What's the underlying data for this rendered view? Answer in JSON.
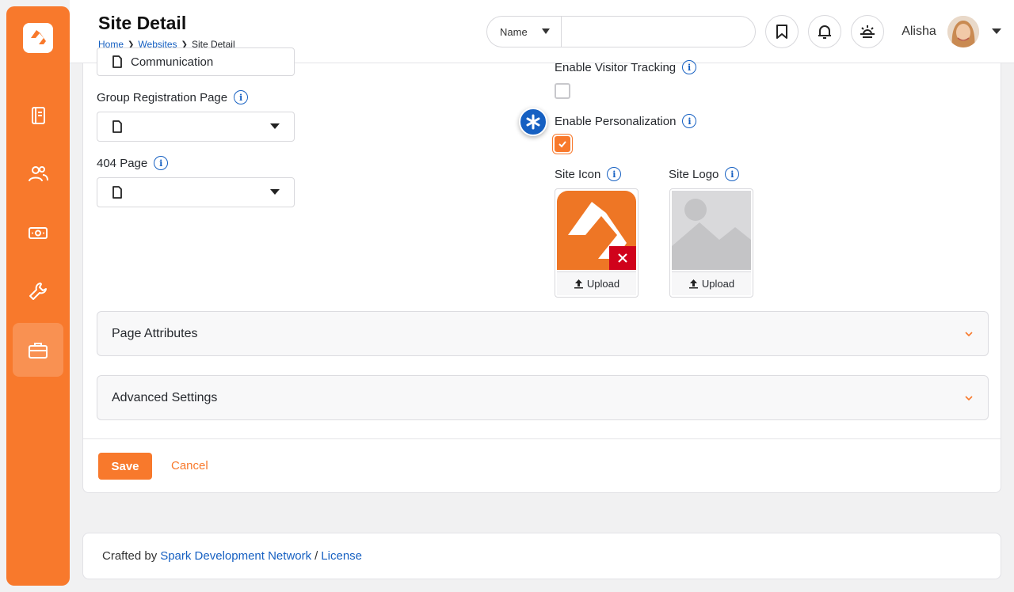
{
  "header": {
    "title": "Site Detail",
    "breadcrumb": [
      "Home",
      "Websites",
      "Site Detail"
    ],
    "search": {
      "type_label": "Name",
      "placeholder": ""
    },
    "user": {
      "name": "Alisha"
    }
  },
  "sidebar": {
    "items": [
      "book-icon",
      "people-icon",
      "money-icon",
      "wrench-icon",
      "briefcase-icon"
    ],
    "active_index": 4
  },
  "form": {
    "partial_field_text": "Communication",
    "group_registration_label": "Group Registration Page",
    "page_404_label": "404 Page",
    "visitor_tracking_label": "Enable Visitor Tracking",
    "visitor_tracking_checked": false,
    "personalization_label": "Enable Personalization",
    "personalization_checked": true,
    "site_icon_label": "Site Icon",
    "site_logo_label": "Site Logo",
    "upload_label": "Upload",
    "panels": [
      "Page Attributes",
      "Advanced Settings"
    ],
    "save_label": "Save",
    "cancel_label": "Cancel"
  },
  "footer": {
    "prefix": "Crafted by",
    "link": "Spark Development Network",
    "separator": "/",
    "license": "License"
  },
  "colors": {
    "accent": "#f8792c",
    "link": "#1660c2",
    "danger": "#d0021b"
  }
}
